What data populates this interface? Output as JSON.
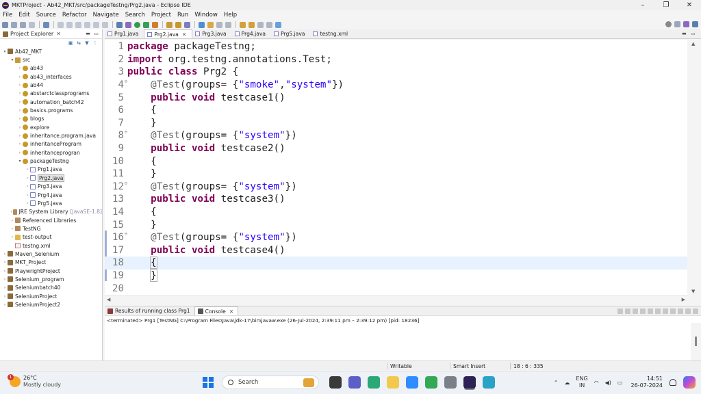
{
  "window": {
    "title": "MKTProject - Ab42_MKT/src/packageTestng/Prg2.java - Eclipse IDE",
    "controls": [
      "–",
      "❐",
      "✕"
    ]
  },
  "menu": [
    "File",
    "Edit",
    "Source",
    "Refactor",
    "Navigate",
    "Search",
    "Project",
    "Run",
    "Window",
    "Help"
  ],
  "explorer": {
    "title": "Project Explorer",
    "tree": [
      {
        "label": "Ab42_MKT",
        "indent": 0,
        "arrow": "▾",
        "icon": "proj"
      },
      {
        "label": "src",
        "indent": 1,
        "arrow": "▾",
        "icon": "src"
      },
      {
        "label": "ab43",
        "indent": 2,
        "arrow": "›",
        "icon": "pkg"
      },
      {
        "label": "ab43_interfaces",
        "indent": 2,
        "arrow": "›",
        "icon": "pkg"
      },
      {
        "label": "ab44",
        "indent": 2,
        "arrow": "›",
        "icon": "pkg"
      },
      {
        "label": "abstarctclassprograms",
        "indent": 2,
        "arrow": "›",
        "icon": "pkg"
      },
      {
        "label": "automation_batch42",
        "indent": 2,
        "arrow": "›",
        "icon": "pkg"
      },
      {
        "label": "basics.programs",
        "indent": 2,
        "arrow": "›",
        "icon": "pkg"
      },
      {
        "label": "blogs",
        "indent": 2,
        "arrow": "›",
        "icon": "pkg"
      },
      {
        "label": "explore",
        "indent": 2,
        "arrow": "›",
        "icon": "pkg"
      },
      {
        "label": "inheritance.program.java",
        "indent": 2,
        "arrow": "›",
        "icon": "pkg"
      },
      {
        "label": "inheritanceProgram",
        "indent": 2,
        "arrow": "›",
        "icon": "pkg"
      },
      {
        "label": "inheritanceprogran",
        "indent": 2,
        "arrow": "›",
        "icon": "pkg"
      },
      {
        "label": "packageTestng",
        "indent": 2,
        "arrow": "▾",
        "icon": "pkg"
      },
      {
        "label": "Prg1.java",
        "indent": 3,
        "arrow": "›",
        "icon": "java"
      },
      {
        "label": "Prg2.java",
        "indent": 3,
        "arrow": "›",
        "icon": "java",
        "selected": true
      },
      {
        "label": "Prg3.java",
        "indent": 3,
        "arrow": "›",
        "icon": "java"
      },
      {
        "label": "Prg4.java",
        "indent": 3,
        "arrow": "›",
        "icon": "java"
      },
      {
        "label": "Prg5.java",
        "indent": 3,
        "arrow": "›",
        "icon": "java"
      },
      {
        "label": "JRE System Library",
        "extra": "[JavaSE-1.8]",
        "indent": 1,
        "arrow": "›",
        "icon": "lib"
      },
      {
        "label": "Referenced Libraries",
        "indent": 1,
        "arrow": "›",
        "icon": "lib"
      },
      {
        "label": "TestNG",
        "indent": 1,
        "arrow": "›",
        "icon": "lib"
      },
      {
        "label": "test-output",
        "indent": 1,
        "arrow": "›",
        "icon": "folder"
      },
      {
        "label": "testng.xml",
        "indent": 1,
        "arrow": "",
        "icon": "xml"
      },
      {
        "label": "Maven_Selenium",
        "indent": 0,
        "arrow": "›",
        "icon": "proj"
      },
      {
        "label": "MKT_Project",
        "indent": 0,
        "arrow": "›",
        "icon": "proj"
      },
      {
        "label": "PlaywrightProject",
        "indent": 0,
        "arrow": "›",
        "icon": "proj"
      },
      {
        "label": "Selenium_program",
        "indent": 0,
        "arrow": "›",
        "icon": "proj"
      },
      {
        "label": "Seleniumbatch40",
        "indent": 0,
        "arrow": "›",
        "icon": "proj"
      },
      {
        "label": "SeleniumProject",
        "indent": 0,
        "arrow": "›",
        "icon": "proj"
      },
      {
        "label": "SeleniumProject2",
        "indent": 0,
        "arrow": "›",
        "icon": "proj"
      }
    ]
  },
  "editor_tabs": [
    {
      "label": "Prg1.java",
      "active": false
    },
    {
      "label": "Prg2.java",
      "active": true
    },
    {
      "label": "Prg3.java",
      "active": false
    },
    {
      "label": "Prg4.java",
      "active": false
    },
    {
      "label": "Prg5.java",
      "active": false
    },
    {
      "label": "testng.xml",
      "active": false
    }
  ],
  "code": [
    {
      "n": "1",
      "parts": [
        [
          "kw",
          "package"
        ],
        [
          "t",
          " packageTestng;"
        ]
      ]
    },
    {
      "n": "2",
      "parts": [
        [
          "kw",
          "import"
        ],
        [
          "t",
          " org.testng.annotations.Test;"
        ]
      ]
    },
    {
      "n": "3",
      "parts": [
        [
          "kw",
          "public class"
        ],
        [
          "t",
          " Prg2 {"
        ]
      ]
    },
    {
      "n": "4",
      "fold": "⊖",
      "parts": [
        [
          "t",
          "    "
        ],
        [
          "ann",
          "@Test"
        ],
        [
          "t",
          "(groups= {"
        ],
        [
          "str",
          "\"smoke\""
        ],
        [
          "t",
          ","
        ],
        [
          "str",
          "\"system\""
        ],
        [
          "t",
          "})"
        ]
      ]
    },
    {
      "n": "5",
      "parts": [
        [
          "t",
          "    "
        ],
        [
          "kw",
          "public void"
        ],
        [
          "t",
          " testcase1()"
        ]
      ]
    },
    {
      "n": "6",
      "parts": [
        [
          "t",
          "    {"
        ]
      ]
    },
    {
      "n": "7",
      "parts": [
        [
          "t",
          "    }"
        ]
      ]
    },
    {
      "n": "8",
      "fold": "⊖",
      "parts": [
        [
          "t",
          "    "
        ],
        [
          "ann",
          "@Test"
        ],
        [
          "t",
          "(groups= {"
        ],
        [
          "str",
          "\"system\""
        ],
        [
          "t",
          "})"
        ]
      ]
    },
    {
      "n": "9",
      "parts": [
        [
          "t",
          "    "
        ],
        [
          "kw",
          "public void"
        ],
        [
          "t",
          " testcase2()"
        ]
      ]
    },
    {
      "n": "10",
      "parts": [
        [
          "t",
          "    {"
        ]
      ]
    },
    {
      "n": "11",
      "parts": [
        [
          "t",
          "    }"
        ]
      ]
    },
    {
      "n": "12",
      "fold": "⊖",
      "parts": [
        [
          "t",
          "    "
        ],
        [
          "ann",
          "@Test"
        ],
        [
          "t",
          "(groups= {"
        ],
        [
          "str",
          "\"system\""
        ],
        [
          "t",
          "})"
        ]
      ]
    },
    {
      "n": "13",
      "parts": [
        [
          "t",
          "    "
        ],
        [
          "kw",
          "public void"
        ],
        [
          "t",
          " testcase3()"
        ]
      ]
    },
    {
      "n": "14",
      "parts": [
        [
          "t",
          "    {"
        ]
      ]
    },
    {
      "n": "15",
      "parts": [
        [
          "t",
          "    }"
        ]
      ]
    },
    {
      "n": "16",
      "fold": "⊖",
      "parts": [
        [
          "t",
          "    "
        ],
        [
          "ann",
          "@Test"
        ],
        [
          "t",
          "(groups= {"
        ],
        [
          "str",
          "\"system\""
        ],
        [
          "t",
          "})"
        ]
      ]
    },
    {
      "n": "17",
      "parts": [
        [
          "t",
          "    "
        ],
        [
          "kw",
          "public void"
        ],
        [
          "t",
          " testcase4()"
        ]
      ]
    },
    {
      "n": "18",
      "current": true,
      "parts": [
        [
          "t",
          "    "
        ],
        [
          "box",
          "{"
        ],
        [
          "caret",
          ""
        ]
      ]
    },
    {
      "n": "19",
      "parts": [
        [
          "t",
          "    "
        ],
        [
          "box",
          "}"
        ]
      ]
    },
    {
      "n": "20",
      "parts": []
    }
  ],
  "console": {
    "tabs": [
      {
        "label": "Results of running class Prg1",
        "active": false
      },
      {
        "label": "Console",
        "active": true
      }
    ],
    "terminated": "<terminated> Prg1 [TestNG] C:\\Program Files\\Java\\jdk-17\\bin\\javaw.exe  (26-Jul-2024, 2:39:11 pm – 2:39:12 pm) [pid: 18236]"
  },
  "status": {
    "mode": "Writable",
    "insert": "Smart Insert",
    "position": "18 : 6 : 335"
  },
  "taskbar": {
    "weather_temp": "26°C",
    "weather_desc": "Mostly cloudy",
    "notification_count": "1",
    "search_placeholder": "Search",
    "lang1": "ENG",
    "lang2": "IN",
    "time": "14:51",
    "date": "26-07-2024",
    "apps": [
      {
        "name": "file-explorer-app",
        "color": "#3a3a3a"
      },
      {
        "name": "chat-app",
        "color": "#5b5fc7"
      },
      {
        "name": "snip-app",
        "color": "#2aa876"
      },
      {
        "name": "folder-app",
        "color": "#f2c94c"
      },
      {
        "name": "zoom-app",
        "color": "#2d8cff"
      },
      {
        "name": "chrome-app",
        "color": "#34a853"
      },
      {
        "name": "phone-app",
        "color": "#7b7f87"
      },
      {
        "name": "eclipse-app",
        "color": "#2c2255",
        "running": true
      },
      {
        "name": "browser-app",
        "color": "#2aa1c7"
      }
    ]
  },
  "colors": {
    "keyword": "#7f0055",
    "string": "#2a00ff",
    "annotation": "#646464",
    "current_line": "#e8f2fe"
  }
}
